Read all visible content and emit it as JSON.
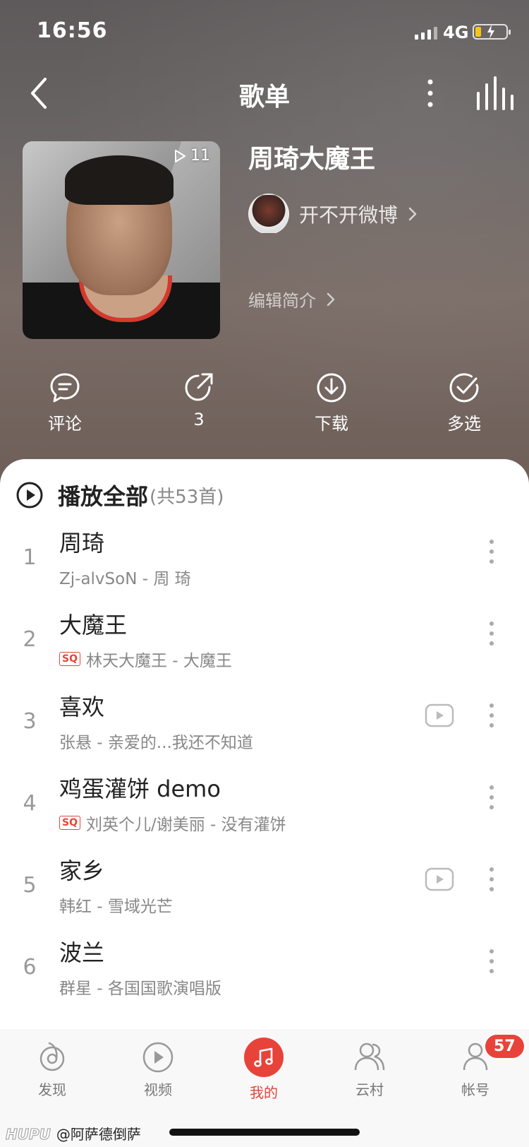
{
  "status_bar": {
    "time": "16:56",
    "network": "4G"
  },
  "header": {
    "title": "歌单"
  },
  "playlist": {
    "play_count": "11",
    "name": "周琦大魔王",
    "creator": "开不开微博",
    "edit_intro": "编辑简介"
  },
  "actions": {
    "comment": "评论",
    "share_count": "3",
    "download": "下载",
    "multi_select": "多选"
  },
  "list": {
    "play_all_label": "播放全部",
    "play_all_count": "(共53首)",
    "songs": [
      {
        "num": "1",
        "title": "周琦",
        "meta": "Zj-alvSoN - 周 琦",
        "sq": false,
        "mv": false
      },
      {
        "num": "2",
        "title": "大魔王",
        "meta": "林天大魔王 - 大魔王",
        "sq": true,
        "mv": false
      },
      {
        "num": "3",
        "title": "喜欢",
        "meta": "张悬 - 亲爱的...我还不知道",
        "sq": false,
        "mv": true
      },
      {
        "num": "4",
        "title": "鸡蛋灌饼 demo",
        "meta": "刘英个儿/谢美丽 - 没有灌饼",
        "sq": true,
        "mv": false
      },
      {
        "num": "5",
        "title": "家乡",
        "meta": "韩红 - 雪域光芒",
        "sq": false,
        "mv": true
      },
      {
        "num": "6",
        "title": "波兰",
        "meta": "群星 - 各国国歌演唱版",
        "sq": false,
        "mv": false
      }
    ],
    "sq_label": "SQ"
  },
  "tab_bar": {
    "discover": "发现",
    "video": "视频",
    "mine": "我的",
    "village": "云村",
    "account": "帐号",
    "account_badge": "57"
  },
  "watermark": {
    "brand": "HUPU",
    "user": "@阿萨德倒萨"
  },
  "colors": {
    "accent": "#e8433a",
    "sq": "#e2453b"
  }
}
